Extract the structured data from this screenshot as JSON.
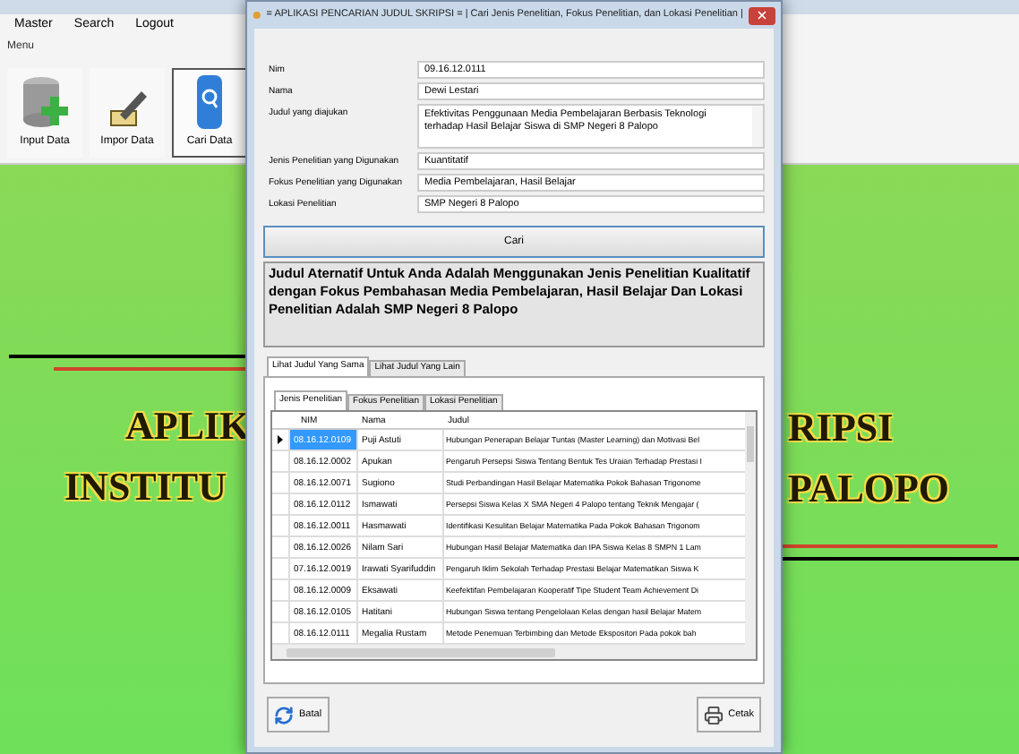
{
  "app": {
    "menu": [
      {
        "label": "Master"
      },
      {
        "label": "Search"
      },
      {
        "label": "Logout"
      }
    ],
    "toolbar_group": "Menu",
    "toolbar": [
      {
        "label": "Input Data",
        "kind": "database",
        "selected": false
      },
      {
        "label": "Impor Data",
        "kind": "edit",
        "selected": false
      },
      {
        "label": "Cari Data",
        "kind": "search",
        "selected": true
      }
    ],
    "banner": {
      "left": [
        "APLIK",
        "INSTITU"
      ],
      "right": [
        "RIPSI",
        "PALOPO"
      ]
    }
  },
  "dialog": {
    "title": "= APLIKASI PENCARIAN JUDUL SKRIPSI = | Cari Jenis Penelitian, Fokus Penelitian, dan Lokasi Penelitian |",
    "fields": [
      {
        "label": "Nim",
        "value": "09.16.12.0111",
        "kind": "single"
      },
      {
        "label": "Nama",
        "value": "Dewi Lestari",
        "kind": "single"
      },
      {
        "label": "Judul yang diajukan",
        "value": "Efektivitas Penggunaan Media Pembelajaran Berbasis Teknologi terhadap Hasil Belajar Siswa di SMP Negeri 8 Palopo",
        "kind": "multi"
      },
      {
        "label": "Jenis Penelitian yang Digunakan",
        "value": "Kuantitatif",
        "kind": "single"
      },
      {
        "label": "Fokus Penelitian yang Digunakan",
        "value": "Media Pembelajaran, Hasil Belajar",
        "kind": "single"
      },
      {
        "label": "Lokasi Penelitian",
        "value": "SMP Negeri 8 Palopo",
        "kind": "single"
      }
    ],
    "search_button": "Cari",
    "result": "Judul Aternatif Untuk Anda Adalah Menggunakan Jenis Penelitian Kualitatif dengan Fokus Pembahasan Media Pembelajaran, Hasil Belajar Dan Lokasi Penelitian Adalah SMP Negeri 8 Palopo",
    "outer_tabs": [
      {
        "label": "Lihat Judul Yang Sama",
        "selected": true
      },
      {
        "label": "Lihat Judul Yang Lain",
        "selected": false
      }
    ],
    "inner_tabs": [
      {
        "label": "Jenis Penelitian",
        "selected": true
      },
      {
        "label": "Fokus Penelitian",
        "selected": false
      },
      {
        "label": "Lokasi Penelitian",
        "selected": false
      }
    ],
    "table": {
      "columns": [
        "NIM",
        "Nama",
        "Judul"
      ],
      "rows": [
        {
          "cells": [
            "08.16.12.0109",
            "Puji Astuti",
            "Hubungan Penerapan Belajar Tuntas (Master Learning) dan Motivasi Bel"
          ],
          "selected": true
        },
        {
          "cells": [
            "08.16.12.0002",
            "Apukan",
            "Pengaruh Persepsi Siswa Tentang Bentuk Tes Uraian Terhadap Prestasi I"
          ],
          "selected": false
        },
        {
          "cells": [
            "08.16.12.0071",
            "Sugiono",
            "Studi Perbandingan Hasil Belajar Matematika Pokok Bahasan Trigonome"
          ],
          "selected": false
        },
        {
          "cells": [
            "08.16.12.0112",
            "Ismawati",
            "Persepsi Siswa Kelas X SMA Negeri 4 Palopo tentang Teknik Mengajar ("
          ],
          "selected": false
        },
        {
          "cells": [
            "08.16.12.0011",
            "Hasmawati",
            "Identifikasi Kesulitan Belajar Matematika Pada Pokok Bahasan Trigonom"
          ],
          "selected": false
        },
        {
          "cells": [
            "08.16.12.0026",
            "Nilam Sari",
            "Hubungan Hasil Belajar Matematika dan IPA Siswa Kelas 8 SMPN 1 Lam"
          ],
          "selected": false
        },
        {
          "cells": [
            "07.16.12.0019",
            "Irawati Syarifuddin",
            "Pengaruh Iklim Sekolah Terhadap Prestasi Belajar Matematikan Siswa K"
          ],
          "selected": false
        },
        {
          "cells": [
            "08.16.12.0009",
            "Eksawati",
            "Keefektifan Pembelajaran Kooperatif Tipe Student Team Achievement Di"
          ],
          "selected": false
        },
        {
          "cells": [
            "08.16.12.0105",
            "Hatitani",
            "Hubungan Siswa tentang Pengelolaan Kelas dengan hasil Belajar Matem"
          ],
          "selected": false
        },
        {
          "cells": [
            "08.16.12.0111",
            "Megalia Rustam",
            "Metode Penemuan Terbimbing dan Metode Ekspositori Pada pokok bah"
          ],
          "selected": false
        }
      ]
    },
    "buttons": {
      "cancel": "Batal",
      "print": "Cetak"
    }
  }
}
